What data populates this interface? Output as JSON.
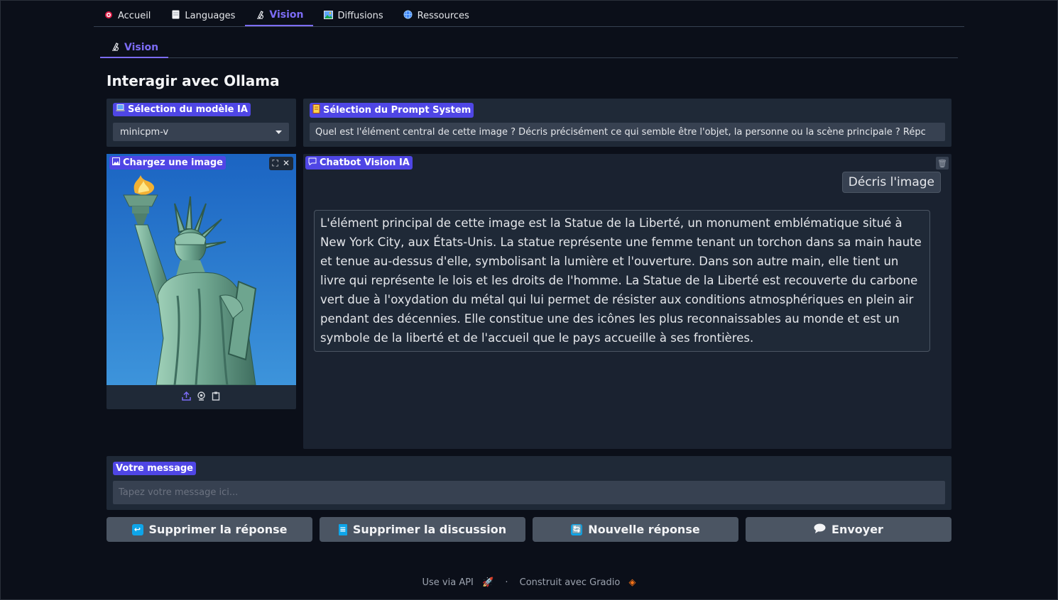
{
  "top_tabs": [
    {
      "label": "Accueil",
      "icon": "target-icon"
    },
    {
      "label": "Languages",
      "icon": "document-icon"
    },
    {
      "label": "Vision",
      "icon": "microscope-icon",
      "active": true
    },
    {
      "label": "Diffusions",
      "icon": "picture-icon"
    },
    {
      "label": "Ressources",
      "icon": "globe-icon"
    }
  ],
  "sub_tab": {
    "label": "Vision",
    "icon": "microscope-icon"
  },
  "page_title": "Interagir avec Ollama",
  "model_select": {
    "label": "Sélection du modèle IA",
    "value": "minicpm-v"
  },
  "prompt_select": {
    "label": "Sélection du Prompt System",
    "value": "Quel est l'élément central de cette image ? Décris précisément ce qui semble être l'objet, la personne ou la scène principale ? Répc"
  },
  "image_upload": {
    "label": "Chargez une image"
  },
  "chatbot": {
    "label": "Chatbot Vision IA",
    "user_message": "Décris l'image",
    "bot_message": "L'élément principal de cette image est la Statue de la Liberté, un monument emblématique situé à New York City, aux États-Unis. La statue représente une femme tenant un torchon dans sa main haute et tenue au-dessus d'elle, symbolisant la lumière et l'ouverture. Dans son autre main, elle tient un livre qui représente le lois et les droits de l'homme. La Statue de la Liberté est recouverte du carbone vert due à l'oxydation du métal qui lui permet de résister aux conditions atmosphériques en plein air pendant des décennies. Elle constitue une des icônes les plus reconnaissables au monde et est un symbole de la liberté et de l'accueil que le pays accueille à ses frontières."
  },
  "message_input": {
    "label": "Votre message",
    "placeholder": "Tapez votre message ici..."
  },
  "buttons": {
    "delete_response": "Supprimer la réponse",
    "delete_discussion": "Supprimer la discussion",
    "new_response": "Nouvelle réponse",
    "send": "Envoyer"
  },
  "footer": {
    "api": "Use via API",
    "separator": "·",
    "built": "Construit avec Gradio"
  },
  "colors": {
    "accent": "#4f46e5",
    "accent_text": "#7c6cf5",
    "background": "#0b0f19",
    "panel": "#1f2937"
  }
}
